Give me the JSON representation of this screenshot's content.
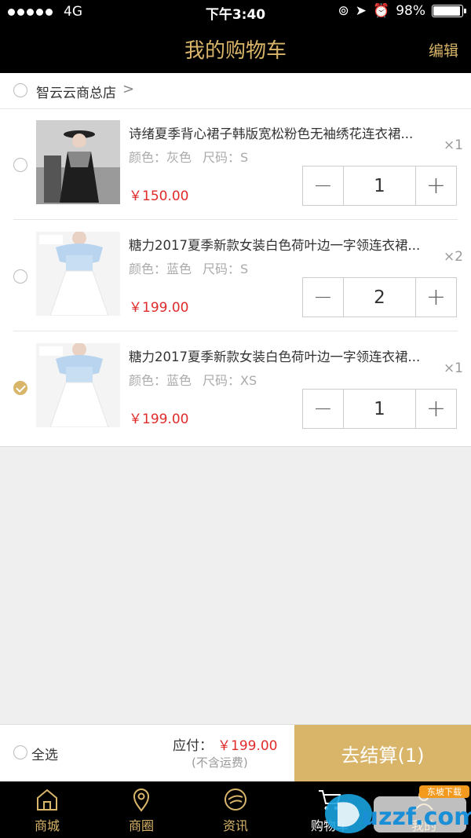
{
  "status_bar": {
    "carrier": "4G",
    "time": "下午3:40",
    "battery": "98%"
  },
  "header": {
    "title": "我的购物车",
    "edit_label": "编辑"
  },
  "store": {
    "name": "智云云商总店",
    "chevron": ">"
  },
  "items": [
    {
      "title": "诗绪夏季背心裙子韩版宽松粉色无袖绣花连衣裙...",
      "qty_tag": "×1",
      "color_label": "颜色：灰色",
      "size_label": "尺码：S",
      "price": "￥150.00",
      "qty": "1",
      "checked": false
    },
    {
      "title": "糖力2017夏季新款女装白色荷叶边一字领连衣裙...",
      "qty_tag": "×2",
      "color_label": "颜色：蓝色",
      "size_label": "尺码：S",
      "price": "￥199.00",
      "qty": "2",
      "checked": false
    },
    {
      "title": "糖力2017夏季新款女装白色荷叶边一字领连衣裙...",
      "qty_tag": "×1",
      "color_label": "颜色：蓝色",
      "size_label": "尺码：XS",
      "price": "￥199.00",
      "qty": "1",
      "checked": true
    }
  ],
  "stepper": {
    "minus": "−",
    "plus": "+"
  },
  "checkout": {
    "select_all": "全选",
    "pay_label": "应付：",
    "pay_amount": "￥199.00",
    "note": "(不含运费)",
    "button": "去结算(1)"
  },
  "tabs": [
    {
      "label": "商城",
      "icon": "home-icon"
    },
    {
      "label": "商圈",
      "icon": "location-pin-icon"
    },
    {
      "label": "资讯",
      "icon": "news-icon"
    },
    {
      "label": "购物车",
      "icon": "cart-icon"
    },
    {
      "label": "我的",
      "icon": "user-icon"
    }
  ],
  "colors": {
    "accent": "#d9b56a",
    "price": "#e02b2b",
    "bar": "#000000"
  },
  "watermark": {
    "text": "uzzf.com",
    "sub": "东坡下载"
  }
}
